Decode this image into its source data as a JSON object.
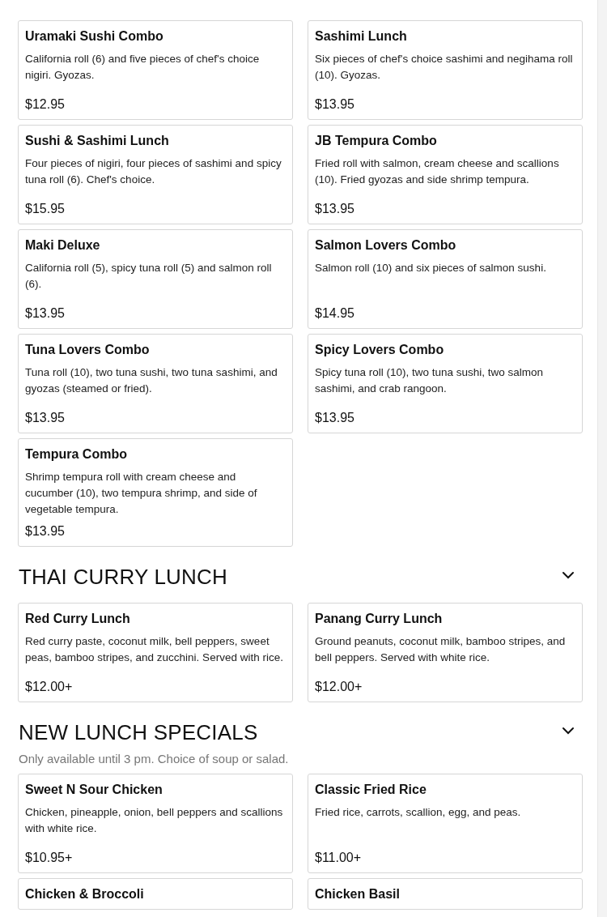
{
  "sections": [
    {
      "items": [
        {
          "name": "Uramaki Sushi Combo",
          "description": "California roll (6) and five pieces of chef's choice nigiri. Gyozas.",
          "price": "$12.95"
        },
        {
          "name": "Sashimi Lunch",
          "description": "Six pieces of chef's choice sashimi and negihama roll (10). Gyozas.",
          "price": "$13.95"
        },
        {
          "name": "Sushi & Sashimi Lunch",
          "description": "Four pieces of nigiri, four pieces of sashimi and spicy tuna roll (6). Chef's choice.",
          "price": "$15.95"
        },
        {
          "name": "JB Tempura Combo",
          "description": "Fried roll with salmon, cream cheese and scallions (10). Fried gyozas and side shrimp tempura.",
          "price": "$13.95"
        },
        {
          "name": "Maki Deluxe",
          "description": "California roll (5), spicy tuna roll (5) and salmon roll (6).",
          "price": "$13.95"
        },
        {
          "name": "Salmon Lovers Combo",
          "description": "Salmon roll (10) and six pieces of salmon sushi.",
          "price": "$14.95"
        },
        {
          "name": "Tuna Lovers Combo",
          "description": "Tuna roll (10), two tuna sushi, two tuna sashimi, and gyozas (steamed or fried).",
          "price": "$13.95"
        },
        {
          "name": "Spicy Lovers Combo",
          "description": "Spicy tuna roll (10), two tuna sushi, two salmon sashimi, and crab rangoon.",
          "price": "$13.95"
        },
        {
          "name": "Tempura Combo",
          "description": "Shrimp tempura roll with cream cheese and cucumber (10), two tempura shrimp, and side of vegetable tempura.",
          "price": "$13.95"
        }
      ]
    },
    {
      "title": "THAI CURRY LUNCH",
      "expanded": true,
      "items": [
        {
          "name": "Red Curry Lunch",
          "description": "Red curry paste, coconut milk, bell peppers, sweet peas, bamboo stripes, and zucchini. Served with rice.",
          "price": "$12.00+"
        },
        {
          "name": "Panang Curry Lunch",
          "description": "Ground peanuts, coconut milk, bamboo stripes, and bell peppers. Served with white rice.",
          "price": "$12.00+"
        }
      ]
    },
    {
      "title": "NEW LUNCH SPECIALS",
      "expanded": true,
      "note": "Only available until 3 pm. Choice of soup or salad.",
      "items": [
        {
          "name": "Sweet N Sour Chicken",
          "description": "Chicken, pineapple, onion, bell peppers and scallions with white rice.",
          "price": "$10.95+"
        },
        {
          "name": "Classic Fried Rice",
          "description": "Fried rice, carrots, scallion, egg, and peas.",
          "price": "$11.00+"
        },
        {
          "name": "Chicken & Broccoli"
        },
        {
          "name": "Chicken Basil"
        }
      ]
    }
  ]
}
